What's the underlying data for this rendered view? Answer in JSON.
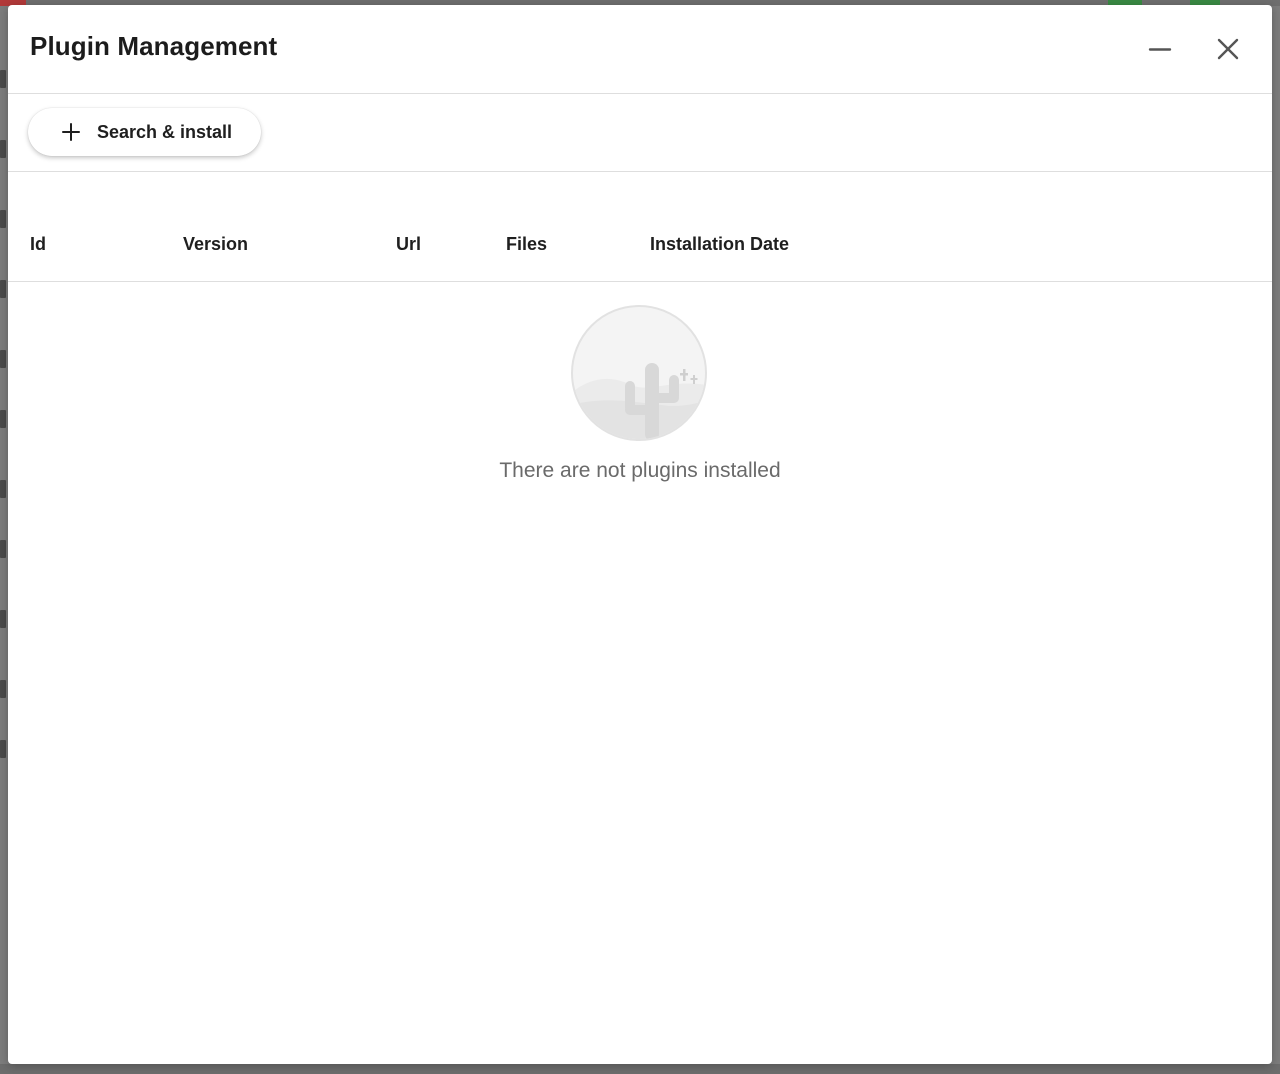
{
  "dialog": {
    "title": "Plugin Management",
    "minimize_icon": "minimize-icon",
    "close_icon": "close-icon"
  },
  "toolbar": {
    "search_install_label": "Search & install",
    "search_install_icon": "plus-icon"
  },
  "table": {
    "columns": [
      "Id",
      "Version",
      "Url",
      "Files",
      "Installation Date"
    ],
    "rows": []
  },
  "empty_state": {
    "illustration_icon": "cactus-desert-icon",
    "message": "There are not plugins installed"
  },
  "colors": {
    "title_text": "#1c1c1c",
    "muted_text": "#6a6a6a",
    "divider": "#dedede",
    "illustration_fill": "#e6e6e6"
  }
}
